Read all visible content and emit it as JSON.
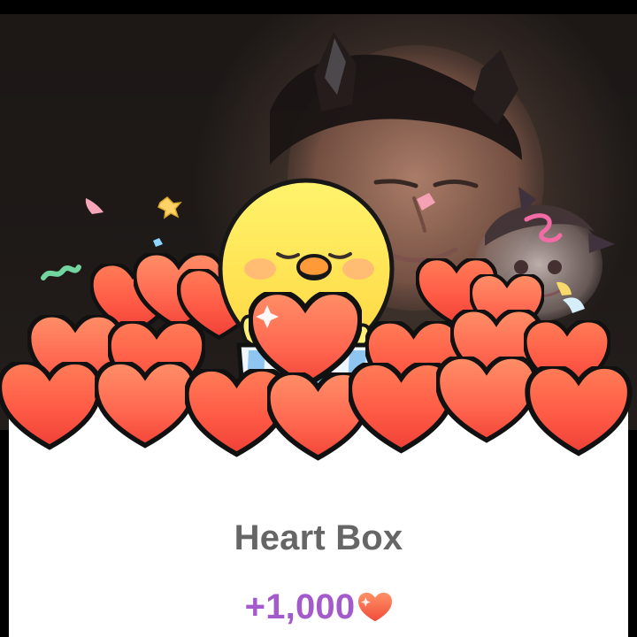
{
  "reward_dialog": {
    "title": "Heart Box",
    "amount": "+1,000",
    "icons": {
      "reward": "heart-icon",
      "mascot": "chick-icon",
      "gift": "gift-box-icon"
    }
  }
}
